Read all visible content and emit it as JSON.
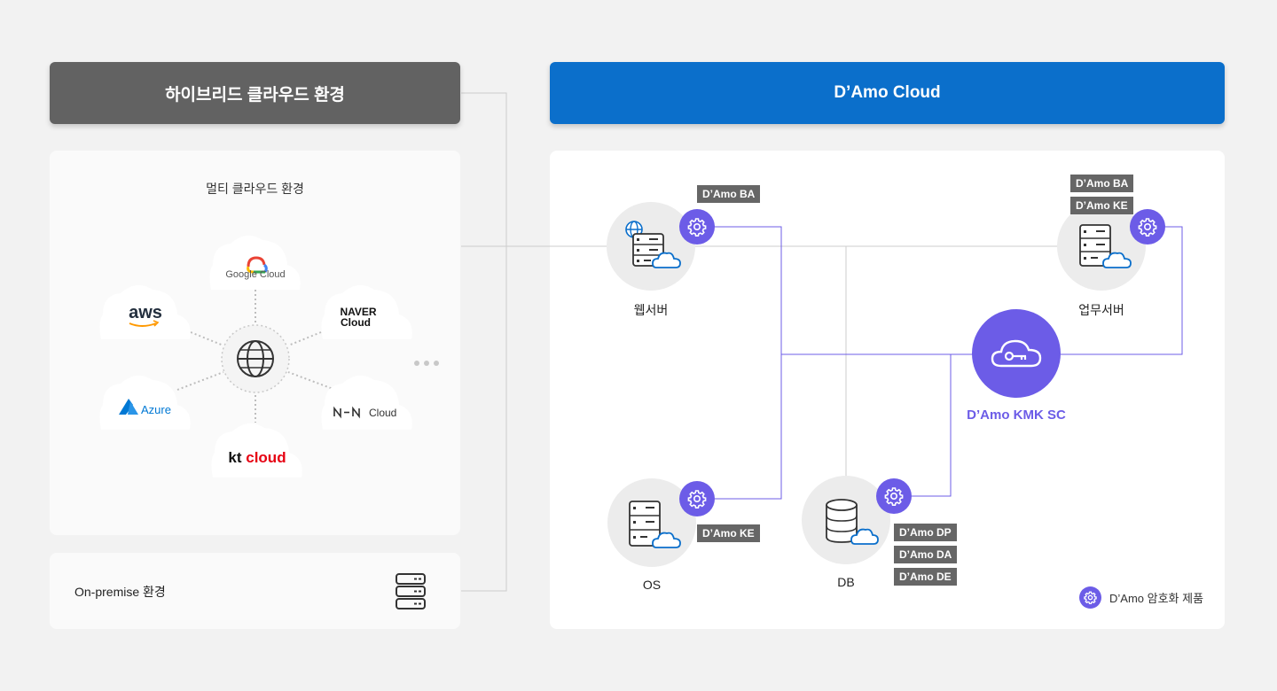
{
  "left": {
    "header": "하이브리드 클라우드 환경",
    "multi_title": "멀티 클라우드 환경",
    "providers": {
      "google": "Google Cloud",
      "aws": "aws",
      "naver_line1": "NAVER",
      "naver_line2": "Cloud",
      "azure": "Azure",
      "nhn": "Cloud",
      "kt_k": "kt",
      "kt_cloud": "cloud"
    },
    "onpremise": "On-premise 환경"
  },
  "right": {
    "header": "D’Amo Cloud",
    "nodes": {
      "web": {
        "label": "웹서버",
        "tags": [
          "D’Amo BA"
        ]
      },
      "biz": {
        "label": "업무서버",
        "tags": [
          "D’Amo BA",
          "D’Amo KE"
        ]
      },
      "os": {
        "label": "OS",
        "tags": [
          "D’Amo KE"
        ]
      },
      "db": {
        "label": "DB",
        "tags": [
          "D’Amo DP",
          "D’Amo DA",
          "D’Amo DE"
        ]
      },
      "kmk": {
        "label": "D’Amo KMK SC"
      }
    },
    "legend": "D’Amo 암호화 제품"
  },
  "colors": {
    "left_header": "#626262",
    "right_header": "#0b6fcb",
    "accent": "#6c5ce7",
    "tag": "#666666",
    "line": "#cccccc"
  }
}
